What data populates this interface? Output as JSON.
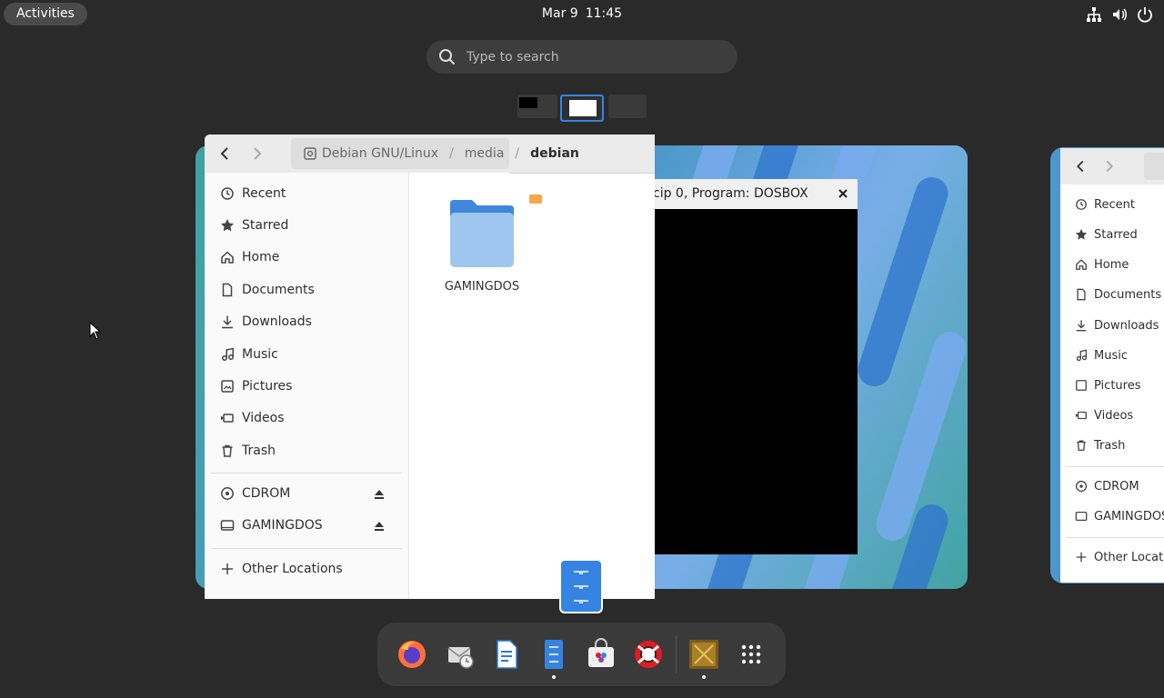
{
  "topbar": {
    "activities_label": "Activities",
    "date": "Mar 9",
    "time": "11:45",
    "icons": [
      "network-icon",
      "volume-icon",
      "power-icon"
    ]
  },
  "search": {
    "placeholder": "Type to search"
  },
  "files_window": {
    "path": [
      "Debian GNU/Linux",
      "media",
      "debian"
    ],
    "sidebar": {
      "places": [
        "Recent",
        "Starred",
        "Home",
        "Documents",
        "Downloads",
        "Music",
        "Pictures",
        "Videos",
        "Trash"
      ],
      "devices": [
        "CDROM",
        "GAMINGDOS"
      ],
      "other": "Other Locations"
    },
    "items": [
      {
        "name": "GAMINGDOS",
        "icon": "folder-icon"
      }
    ]
  },
  "dosbox_window": {
    "title": "cip 0, Program:  DOSBOX"
  },
  "files_window_2": {
    "sidebar": [
      "Recent",
      "Starred",
      "Home",
      "Documents",
      "Downloads",
      "Music",
      "Pictures",
      "Videos",
      "Trash",
      "CDROM",
      "GAMINGDOS",
      "Other Locatio"
    ]
  },
  "dash": {
    "apps": [
      "firefox-icon",
      "evolution-icon",
      "libreoffice-writer-icon",
      "files-icon",
      "software-icon",
      "help-icon",
      "dosbox-icon",
      "app-grid-icon"
    ]
  },
  "colors": {
    "accent": "#3584e4",
    "panel": "#2a2a2a",
    "folder": "#4a90d9"
  }
}
